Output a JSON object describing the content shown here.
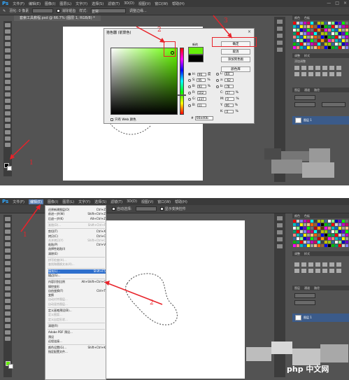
{
  "top": {
    "menubar": {
      "logo": "Ps",
      "items": [
        "文件(F)",
        "编辑(E)",
        "图像(I)",
        "图层(L)",
        "文字(Y)",
        "选择(S)",
        "滤镜(T)",
        "3D(D)",
        "视图(V)",
        "窗口(W)",
        "帮助(H)"
      ],
      "win_controls": [
        "—",
        "□",
        "×"
      ]
    },
    "options": {
      "feather_label": "羽化: 0 像素",
      "antialias_label": "消除锯齿",
      "style_label": "样式:",
      "style_value": "正常",
      "refine_label": "调整边缘..."
    },
    "doc_tab": "套索工具教程.psd @ 66.7% (图层 1, RGB/8) *",
    "dialog": {
      "title": "拾色器 (前景色)",
      "close": "×",
      "new_label": "新的",
      "current_label": "当前",
      "new_color": "#66ed0b",
      "current_color": "#000000",
      "buttons": [
        "确定",
        "取消",
        "添加到色板",
        "颜色库"
      ],
      "values_left": [
        {
          "label": "H:",
          "value": "96",
          "unit": "度",
          "on": true
        },
        {
          "label": "S:",
          "value": "95",
          "unit": "%",
          "on": false
        },
        {
          "label": "B:",
          "value": "93",
          "unit": "%",
          "on": false
        },
        {
          "label": "R:",
          "value": "102",
          "unit": "",
          "on": false
        },
        {
          "label": "G:",
          "value": "237",
          "unit": "",
          "on": false
        },
        {
          "label": "B:",
          "value": "11",
          "unit": "",
          "on": false
        }
      ],
      "values_right": [
        {
          "label": "L:",
          "value": "84",
          "unit": ""
        },
        {
          "label": "a:",
          "value": "-62",
          "unit": ""
        },
        {
          "label": "b:",
          "value": "78",
          "unit": ""
        },
        {
          "label": "C:",
          "value": "57",
          "unit": "%"
        },
        {
          "label": "M:",
          "value": "0",
          "unit": "%"
        },
        {
          "label": "Y:",
          "value": "96",
          "unit": "%"
        },
        {
          "label": "K:",
          "value": "0",
          "unit": "%"
        }
      ],
      "hex_prefix": "#",
      "hex": "66ed0b",
      "web_only": "只有 Web 颜色"
    },
    "panel": {
      "tabs": [
        "颜色",
        "色板"
      ],
      "adjust_tabs": [
        "调整",
        "样式"
      ],
      "adjust_title": "添加调整",
      "layer_tabs": [
        "图层",
        "通道",
        "路径"
      ],
      "layer_name": "图层 1"
    },
    "annotations": [
      "1",
      "2",
      "3"
    ],
    "annotation_color": "#e8232a"
  },
  "bottom": {
    "menubar": {
      "logo": "Ps",
      "items": [
        "文件(F)",
        "编辑(E)",
        "图像(I)",
        "图层(L)",
        "文字(Y)",
        "选择(S)",
        "滤镜(T)",
        "3D(D)",
        "视图(V)",
        "窗口(W)",
        "帮助(H)"
      ],
      "active_index": 1
    },
    "options": {
      "autoselect": "自动选择:",
      "transform": "显示变换控件"
    },
    "edit_menu": [
      {
        "label": "还原新建图层(O)",
        "shortcut": "Ctrl+Z",
        "dim": false
      },
      {
        "label": "前进一步(W)",
        "shortcut": "Shift+Ctrl+Z",
        "dim": false
      },
      {
        "label": "后退一步(K)",
        "shortcut": "Alt+Ctrl+Z",
        "dim": false
      },
      {
        "sep": true
      },
      {
        "label": "渐隐(D)...",
        "shortcut": "Shift+Ctrl+F",
        "dim": true
      },
      {
        "sep": true
      },
      {
        "label": "剪切(T)",
        "shortcut": "Ctrl+X",
        "dim": false
      },
      {
        "label": "拷贝(C)",
        "shortcut": "Ctrl+C",
        "dim": false
      },
      {
        "label": "合并拷贝(Y)",
        "shortcut": "Shift+Ctrl+C",
        "dim": true
      },
      {
        "label": "粘贴(P)",
        "shortcut": "Ctrl+V",
        "dim": false
      },
      {
        "label": "选择性粘贴(I)",
        "shortcut": "",
        "dim": false
      },
      {
        "label": "清除(E)",
        "shortcut": "",
        "dim": false
      },
      {
        "sep": true
      },
      {
        "label": "拼写检查(H)...",
        "shortcut": "",
        "dim": true
      },
      {
        "label": "查找和替换文本(X)...",
        "shortcut": "",
        "dim": true
      },
      {
        "sep": true
      },
      {
        "label": "填充(L)...",
        "shortcut": "Shift+F5",
        "dim": false,
        "selected": true
      },
      {
        "label": "描边(S)...",
        "shortcut": "",
        "dim": false
      },
      {
        "sep": true
      },
      {
        "label": "内容识别比例",
        "shortcut": "Alt+Shift+Ctrl+C",
        "dim": false
      },
      {
        "label": "操控变形",
        "shortcut": "",
        "dim": false
      },
      {
        "label": "自由变换(F)",
        "shortcut": "Ctrl+T",
        "dim": false
      },
      {
        "label": "变换",
        "shortcut": "",
        "dim": false
      },
      {
        "label": "自动对齐图层...",
        "shortcut": "",
        "dim": true
      },
      {
        "label": "自动混合图层...",
        "shortcut": "",
        "dim": true
      },
      {
        "sep": true
      },
      {
        "label": "定义画笔预设(B)...",
        "shortcut": "",
        "dim": false
      },
      {
        "label": "定义图案...",
        "shortcut": "",
        "dim": true
      },
      {
        "label": "定义自定形状...",
        "shortcut": "",
        "dim": true
      },
      {
        "sep": true
      },
      {
        "label": "清理(R)",
        "shortcut": "",
        "dim": false
      },
      {
        "sep": true
      },
      {
        "label": "Adobe PDF 预设...",
        "shortcut": "",
        "dim": false
      },
      {
        "label": "预设",
        "shortcut": "",
        "dim": false
      },
      {
        "label": "远程连接...",
        "shortcut": "",
        "dim": false
      },
      {
        "sep": true
      },
      {
        "label": "颜色设置(G)...",
        "shortcut": "Shift+Ctrl+K",
        "dim": false
      },
      {
        "label": "指定配置文件...",
        "shortcut": "",
        "dim": false
      }
    ],
    "panel": {
      "layer_name": "图层 1"
    },
    "annotations": [
      "1",
      "2"
    ]
  },
  "watermark": "php 中文网"
}
